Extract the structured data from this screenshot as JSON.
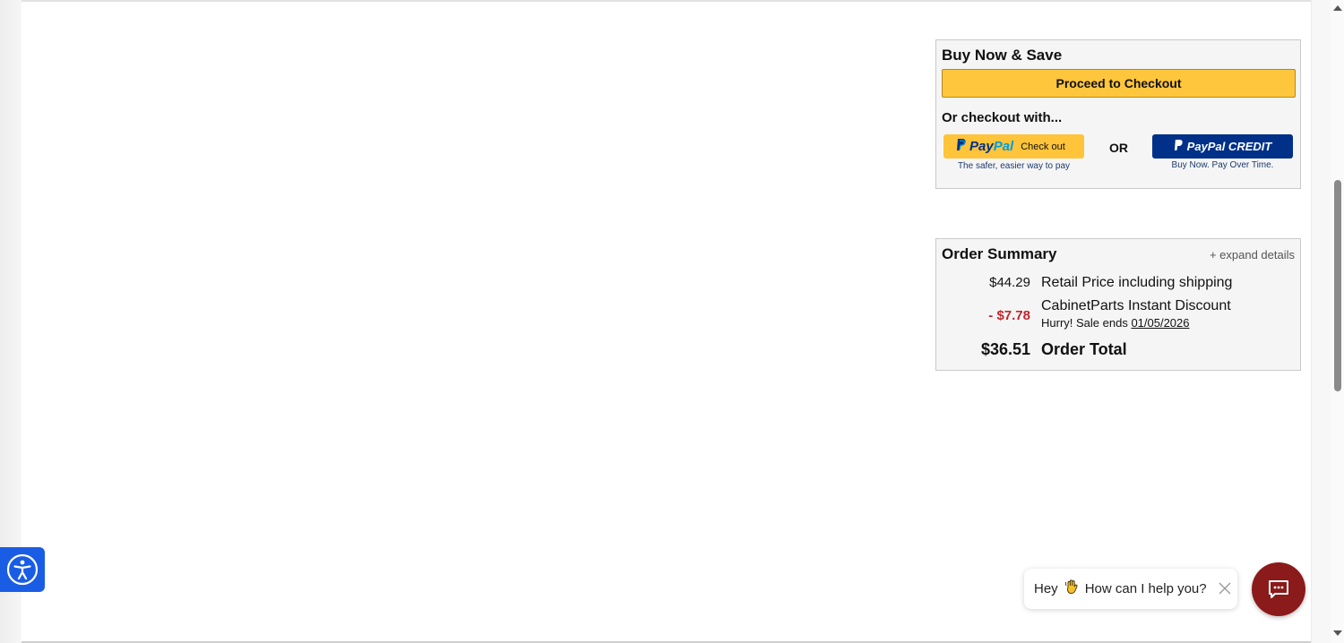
{
  "buy_box": {
    "title": "Buy Now & Save",
    "checkout_button": "Proceed to Checkout",
    "or_checkout_with": "Or checkout with...",
    "paypal": {
      "word_pay": "Pay",
      "word_pal": "Pal",
      "action": "Check out",
      "tagline": "The safer, easier way to pay"
    },
    "or_separator": "OR",
    "paypal_credit": {
      "label": "PayPal CREDIT",
      "tagline": "Buy Now. Pay Over Time."
    }
  },
  "order_summary": {
    "title": "Order Summary",
    "expand_link": "+ expand details",
    "retail": {
      "amount": "$44.29",
      "label": "Retail Price including shipping"
    },
    "discount": {
      "amount": "- $7.78",
      "label": "CabinetParts Instant Discount",
      "note_prefix": "Hurry! Sale ends ",
      "note_date": "01/05/2026"
    },
    "total": {
      "amount": "$36.51",
      "label": "Order Total"
    }
  },
  "chat": {
    "greeting": "Hey",
    "greeting_icon": "waving-hand-icon",
    "message": "How can I help you?",
    "close_icon": "close-icon",
    "fab_icon": "chat-bubble-icon"
  },
  "accessibility": {
    "icon": "accessibility-icon"
  },
  "colors": {
    "checkout_button": "#fec63c",
    "paypal_yellow": "#ffc439",
    "paypal_navy": "#003087",
    "paypal_light_blue": "#009cde",
    "discount_red": "#c0272d",
    "chat_fab": "#8b1a1a",
    "accessibility_blue": "#1a5de5"
  }
}
